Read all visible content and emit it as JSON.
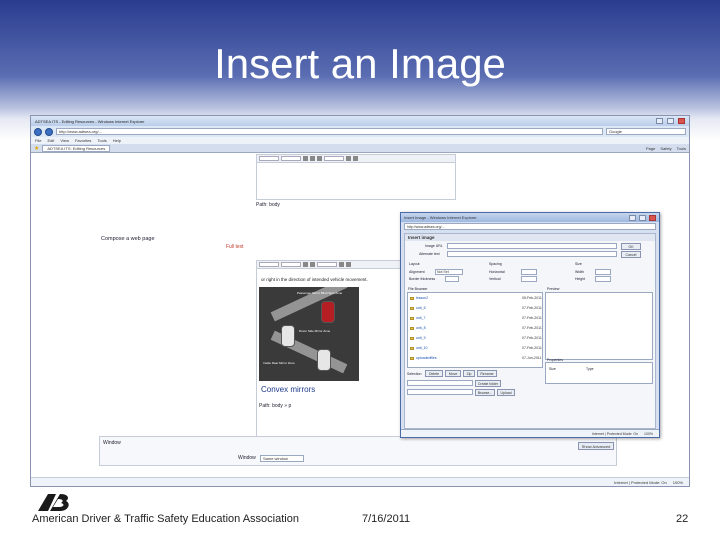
{
  "slide": {
    "title": "Insert an Image",
    "footer_org": "American Driver & Traffic Safety Education Association",
    "footer_date": "7/16/2011",
    "footer_page": "22"
  },
  "browser": {
    "window_title": "ADTSEA ITS - Editing Resources - Windows Internet Explorer",
    "url": "http://www.adtsea.org/...",
    "search_placeholder": "Google",
    "menu": [
      "File",
      "Edit",
      "View",
      "Favorites",
      "Tools",
      "Help"
    ],
    "tab_label": "ADTSEA ITS: Editing Resources",
    "page_tools": [
      "Page",
      "Safety",
      "Tools"
    ],
    "status": [
      "Internet | Protected Mode: On",
      "100%"
    ]
  },
  "page": {
    "compose_label": "Compose a web page",
    "full_text_label": "Full text",
    "path_label": "Path: body",
    "path_label2": "Path: body » p",
    "lesson_text": "or right in the direction of intended vehicle movement.",
    "convex_title": "Convex mirrors",
    "diagram_labels": {
      "top": "Passenger Mirror Blind Spot Zone",
      "mid": "Driver Side Mirror Zone",
      "bot": "Inside Rear Mirror Zone"
    },
    "window_section": {
      "heading": "Window",
      "label": "Window",
      "select_value": "Same window",
      "show_button": "Show Advanced"
    }
  },
  "dialog": {
    "title": "Insert Image - Windows Internet Explorer",
    "url": "http://www.adtsea.org/...",
    "heading": "Insert image",
    "image_url_label": "Image URL",
    "alt_label": "Alternate text",
    "ok_button": "OK",
    "cancel_button": "Cancel",
    "layout_label": "Layout",
    "spacing_label": "Spacing",
    "size_label": "Size",
    "alignment_label": "Alignment",
    "alignment_value": "Not Set",
    "border_label": "Border thickness",
    "horizontal_label": "Horizontal",
    "vertical_label": "Vertical",
    "width_label": "Width",
    "height_label": "Height",
    "file_browser_label": "File Browser",
    "preview_label": "Preview",
    "files": [
      {
        "name": "lesson2",
        "date": "05-Feb-2011"
      },
      {
        "name": "unit_6",
        "date": "07-Feb-2011"
      },
      {
        "name": "unit_7",
        "date": "07-Feb-2011"
      },
      {
        "name": "unit_8",
        "date": "07-Feb-2011"
      },
      {
        "name": "unit_9",
        "date": "07-Feb-2011"
      },
      {
        "name": "unit_10",
        "date": "07-Feb-2011"
      },
      {
        "name": "uploadedfiles",
        "date": "07-Jun-2011"
      }
    ],
    "selection_label": "Selection",
    "delete_button": "Delete",
    "move_button": "Move",
    "zip_button": "Zip",
    "rename_button": "Rename",
    "create_folder_button": "Create folder",
    "browse_button": "Browse...",
    "upload_button": "Upload",
    "properties_label": "Properties",
    "size_prop": "Size",
    "type_prop": "Type",
    "status": [
      "Internet | Protected Mode: On",
      "100%"
    ]
  }
}
